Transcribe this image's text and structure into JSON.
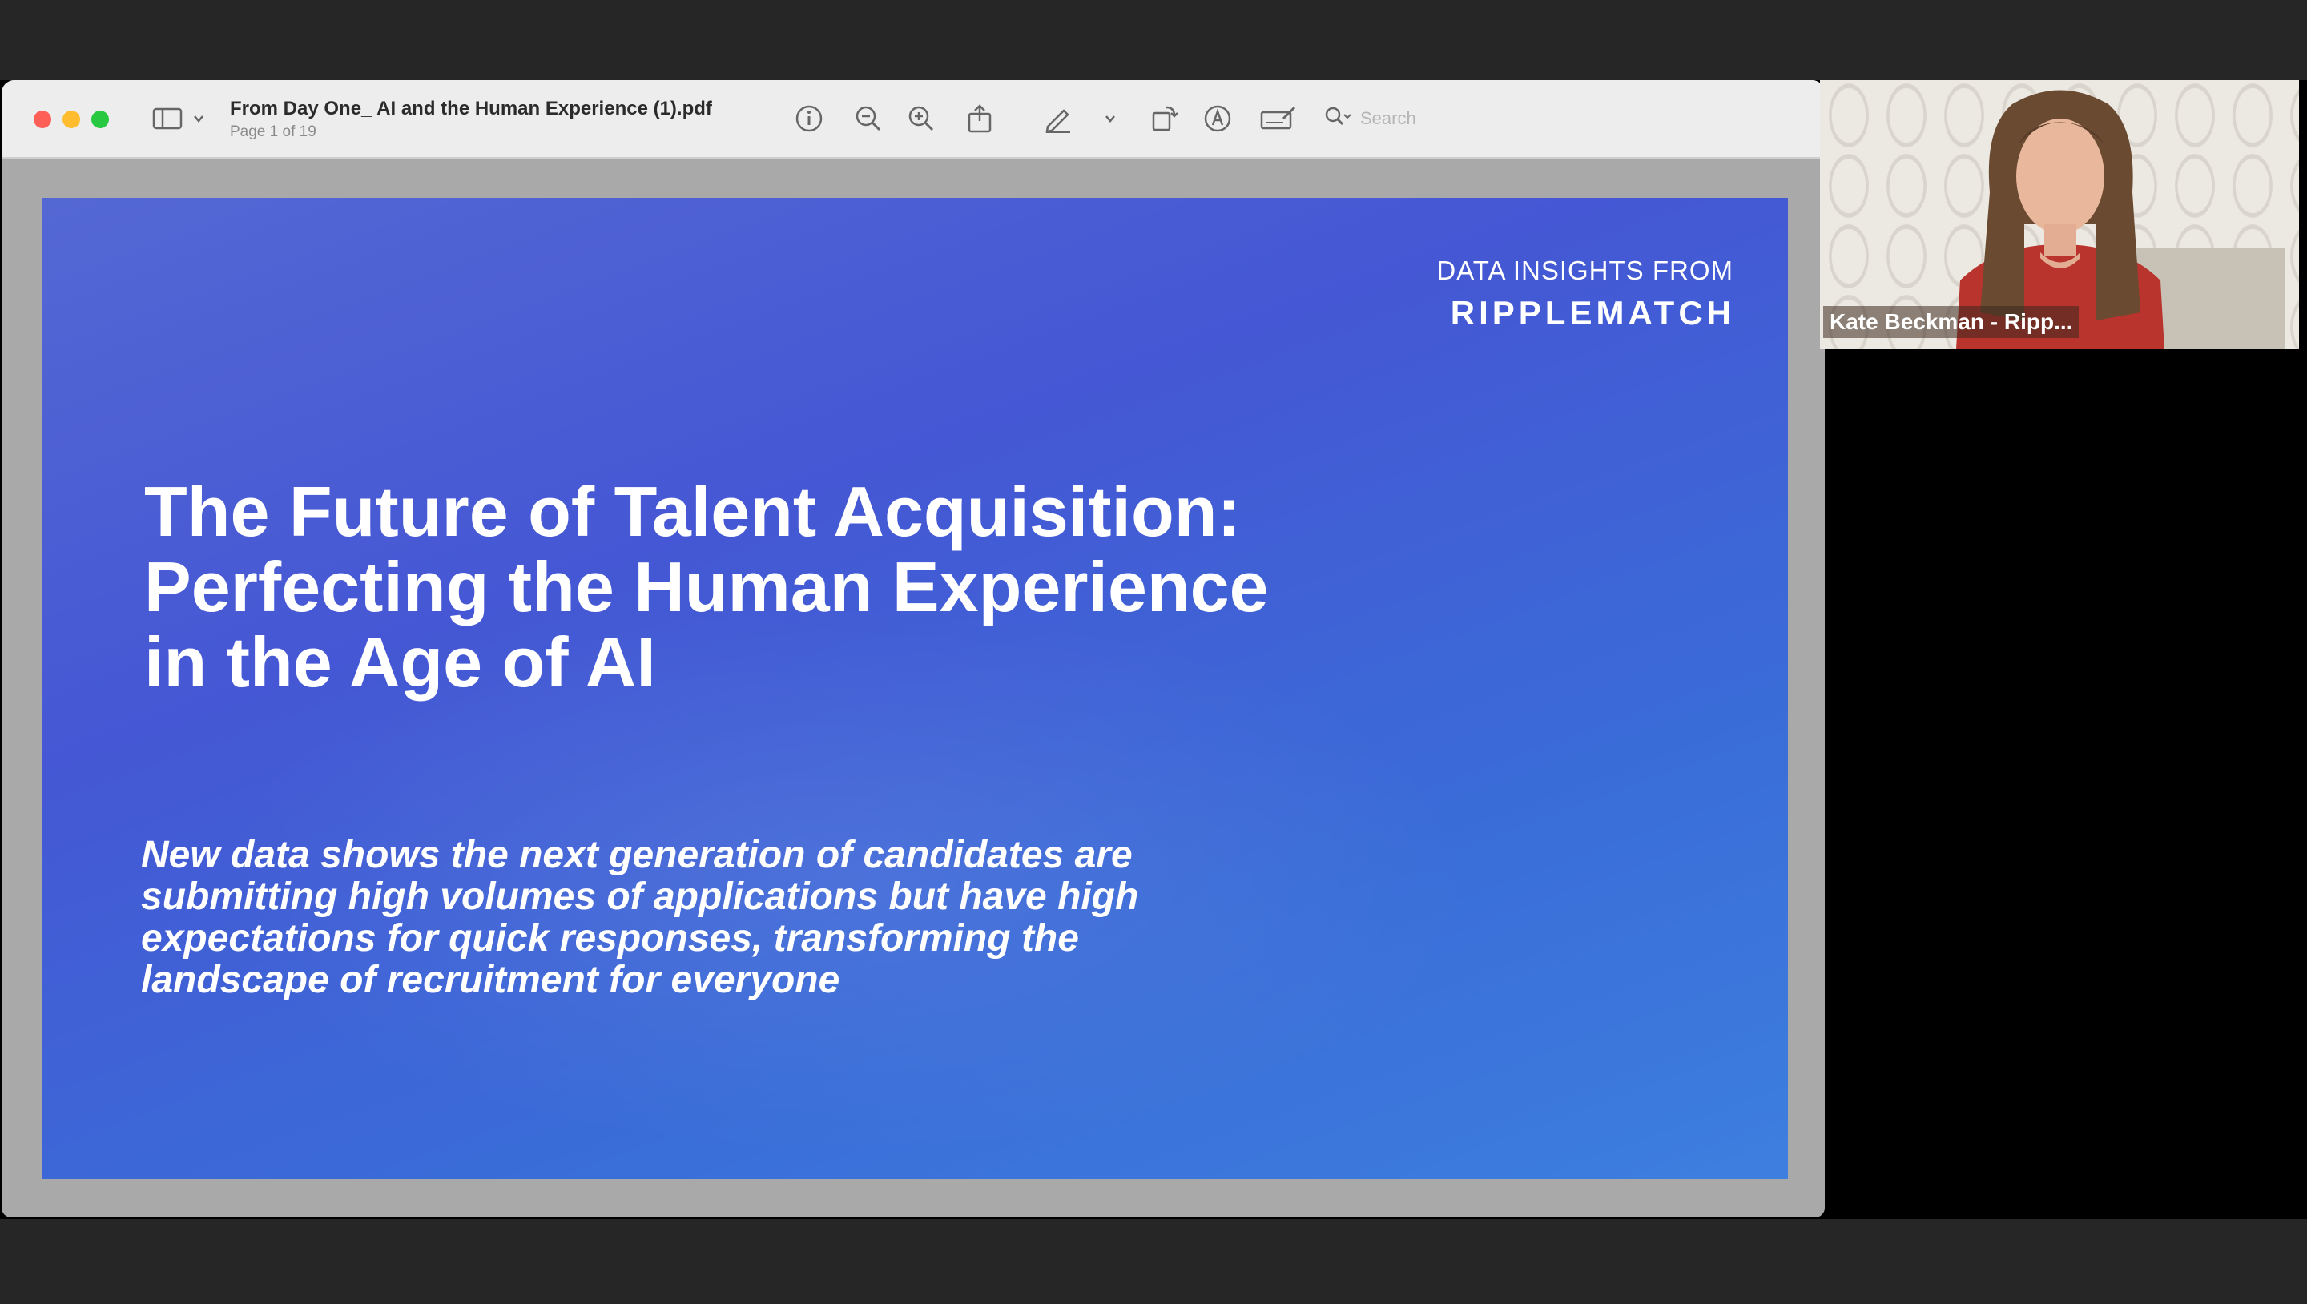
{
  "pdf_viewer": {
    "document_title": "From Day One_ AI and the Human Experience (1).pdf",
    "page_indicator": "Page 1 of 19",
    "toolbar_icons": [
      "sidebar-toggle-icon",
      "chevron-down-icon",
      "info-icon",
      "zoom-out-icon",
      "zoom-in-icon",
      "share-icon",
      "markup-pen-icon",
      "chevron-down-icon",
      "rotate-icon",
      "markup-circle-icon",
      "signature-icon",
      "search-icon"
    ],
    "search": {
      "placeholder": "Search"
    }
  },
  "slide": {
    "brand_label": "DATA INSIGHTS FROM",
    "brand_name": "RIPPLEMATCH",
    "title_lines": [
      "The Future of Talent Acquisition:",
      "Perfecting the Human Experience",
      "in the Age of AI"
    ],
    "subtitle_lines": [
      "New data shows the next generation of candidates are",
      "submitting high volumes of applications but have high",
      "expectations for quick responses, transforming the",
      "landscape of recruitment for everyone"
    ]
  },
  "video": {
    "participant_name": "Kate Beckman - Ripp..."
  },
  "colors": {
    "slide_gradient_start": "#5468d4",
    "slide_gradient_end": "#3d7fdf",
    "toolbar_bg": "#ededed",
    "outer_bar": "#262626"
  }
}
